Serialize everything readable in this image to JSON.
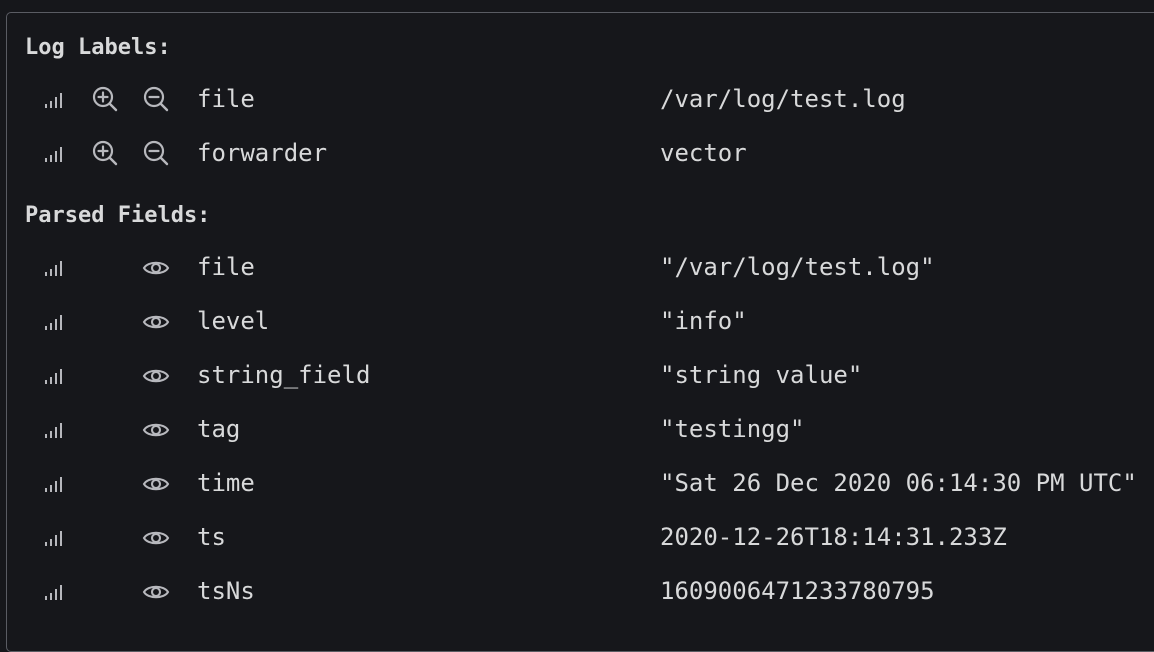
{
  "log_labels": {
    "title": "Log Labels:",
    "rows": [
      {
        "key": "file",
        "value": "/var/log/test.log"
      },
      {
        "key": "forwarder",
        "value": "vector"
      }
    ]
  },
  "parsed_fields": {
    "title": "Parsed Fields:",
    "rows": [
      {
        "key": "file",
        "value": "\"/var/log/test.log\""
      },
      {
        "key": "level",
        "value": "\"info\""
      },
      {
        "key": "string_field",
        "value": "\"string value\""
      },
      {
        "key": "tag",
        "value": "\"testingg\""
      },
      {
        "key": "time",
        "value": "\"Sat 26 Dec 2020 06:14:30 PM UTC\""
      },
      {
        "key": "ts",
        "value": "2020-12-26T18:14:31.233Z"
      },
      {
        "key": "tsNs",
        "value": "1609006471233780795"
      }
    ]
  },
  "icons": {
    "stats": "signal-bars-icon",
    "filter_for": "zoom-in-icon",
    "filter_out": "zoom-out-icon",
    "toggle_field": "eye-icon"
  },
  "colors": {
    "background": "#16171b",
    "border": "#5a5c63",
    "text": "#d8d9da",
    "icon": "#b7b8bd"
  }
}
